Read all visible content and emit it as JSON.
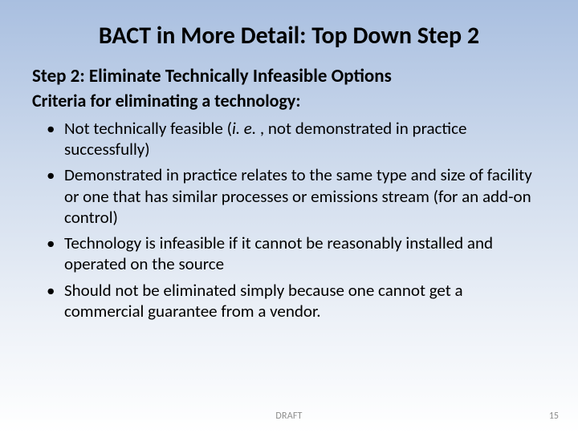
{
  "slide": {
    "title": "BACT in More Detail:  Top Down Step 2",
    "subheading": "Step 2:  Eliminate Technically Infeasible Options",
    "criteria_label": "Criteria for eliminating a technology:",
    "bullets": [
      {
        "prefix": "Not technically feasible (",
        "italic": "i. e. ",
        "suffix": ", not demonstrated in practice successfully)"
      },
      {
        "text": "Demonstrated in practice relates to the same type and size of facility or one that has similar processes or emissions stream (for an add-on control)"
      },
      {
        "text": "Technology is infeasible if it cannot be reasonably installed and operated on the source"
      },
      {
        "text": "Should not be eliminated simply because one cannot get a commercial guarantee from a vendor."
      }
    ],
    "footer_center": "DRAFT",
    "page_number": "15"
  }
}
